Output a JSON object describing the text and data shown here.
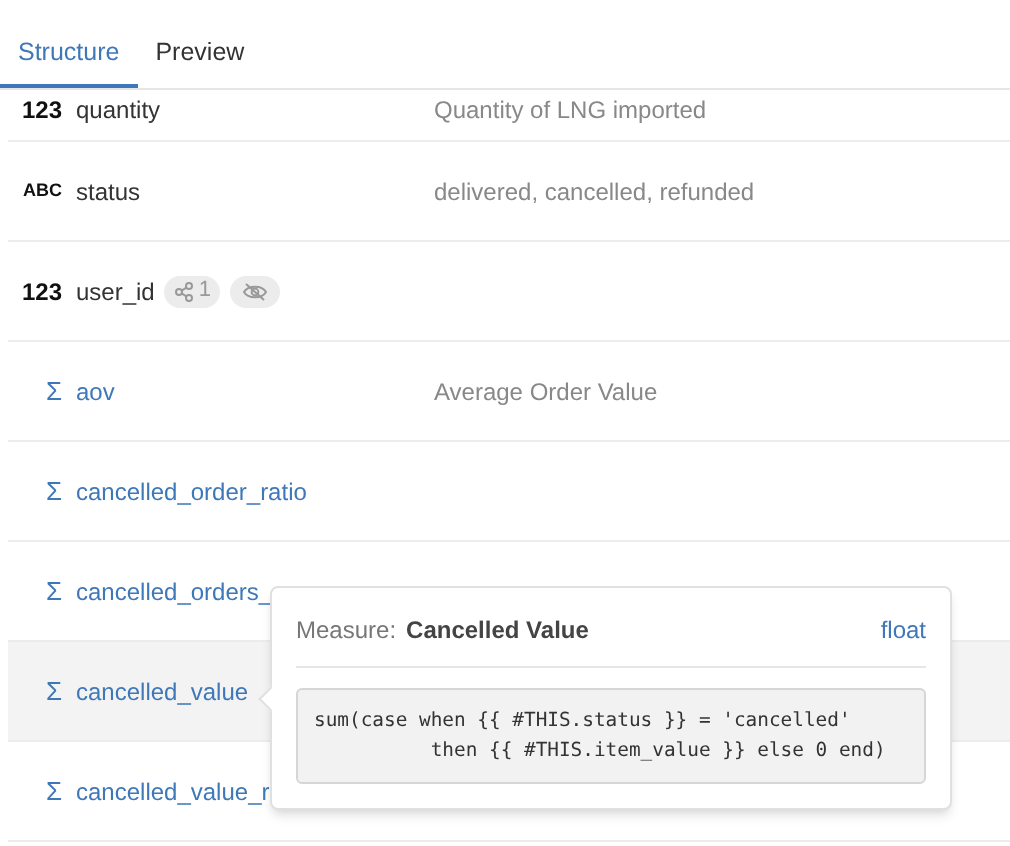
{
  "tabs": [
    {
      "label": "Structure",
      "selected": true
    },
    {
      "label": "Preview",
      "selected": false
    }
  ],
  "fields": [
    {
      "kind": "dimension",
      "type_label": "123",
      "name": "quantity",
      "description": "Quantity of LNG imported",
      "hovered": false
    },
    {
      "kind": "dimension",
      "type_label": "ABC",
      "name": "status",
      "description": "delivered, cancelled, refunded",
      "hovered": false
    },
    {
      "kind": "dimension",
      "type_label": "123",
      "name": "user_id",
      "relations": "1",
      "hidden": true,
      "hovered": false
    },
    {
      "kind": "measure",
      "type_label": "Σ",
      "name": "aov",
      "description": "Average Order Value",
      "hovered": false
    },
    {
      "kind": "measure",
      "type_label": "Σ",
      "name": "cancelled_order_ratio",
      "hovered": false
    },
    {
      "kind": "measure",
      "type_label": "Σ",
      "name": "cancelled_orders_",
      "hovered": false
    },
    {
      "kind": "measure",
      "type_label": "Σ",
      "name": "cancelled_value",
      "hovered": true
    },
    {
      "kind": "measure",
      "type_label": "Σ",
      "name": "cancelled_value_r",
      "hovered": false
    }
  ],
  "popover": {
    "label": "Measure:",
    "title": "Cancelled Value",
    "data_type": "float",
    "sql": "sum(case when {{ #THIS.status }} = 'cancelled'\n          then {{ #THIS.item_value }} else 0 end)"
  }
}
